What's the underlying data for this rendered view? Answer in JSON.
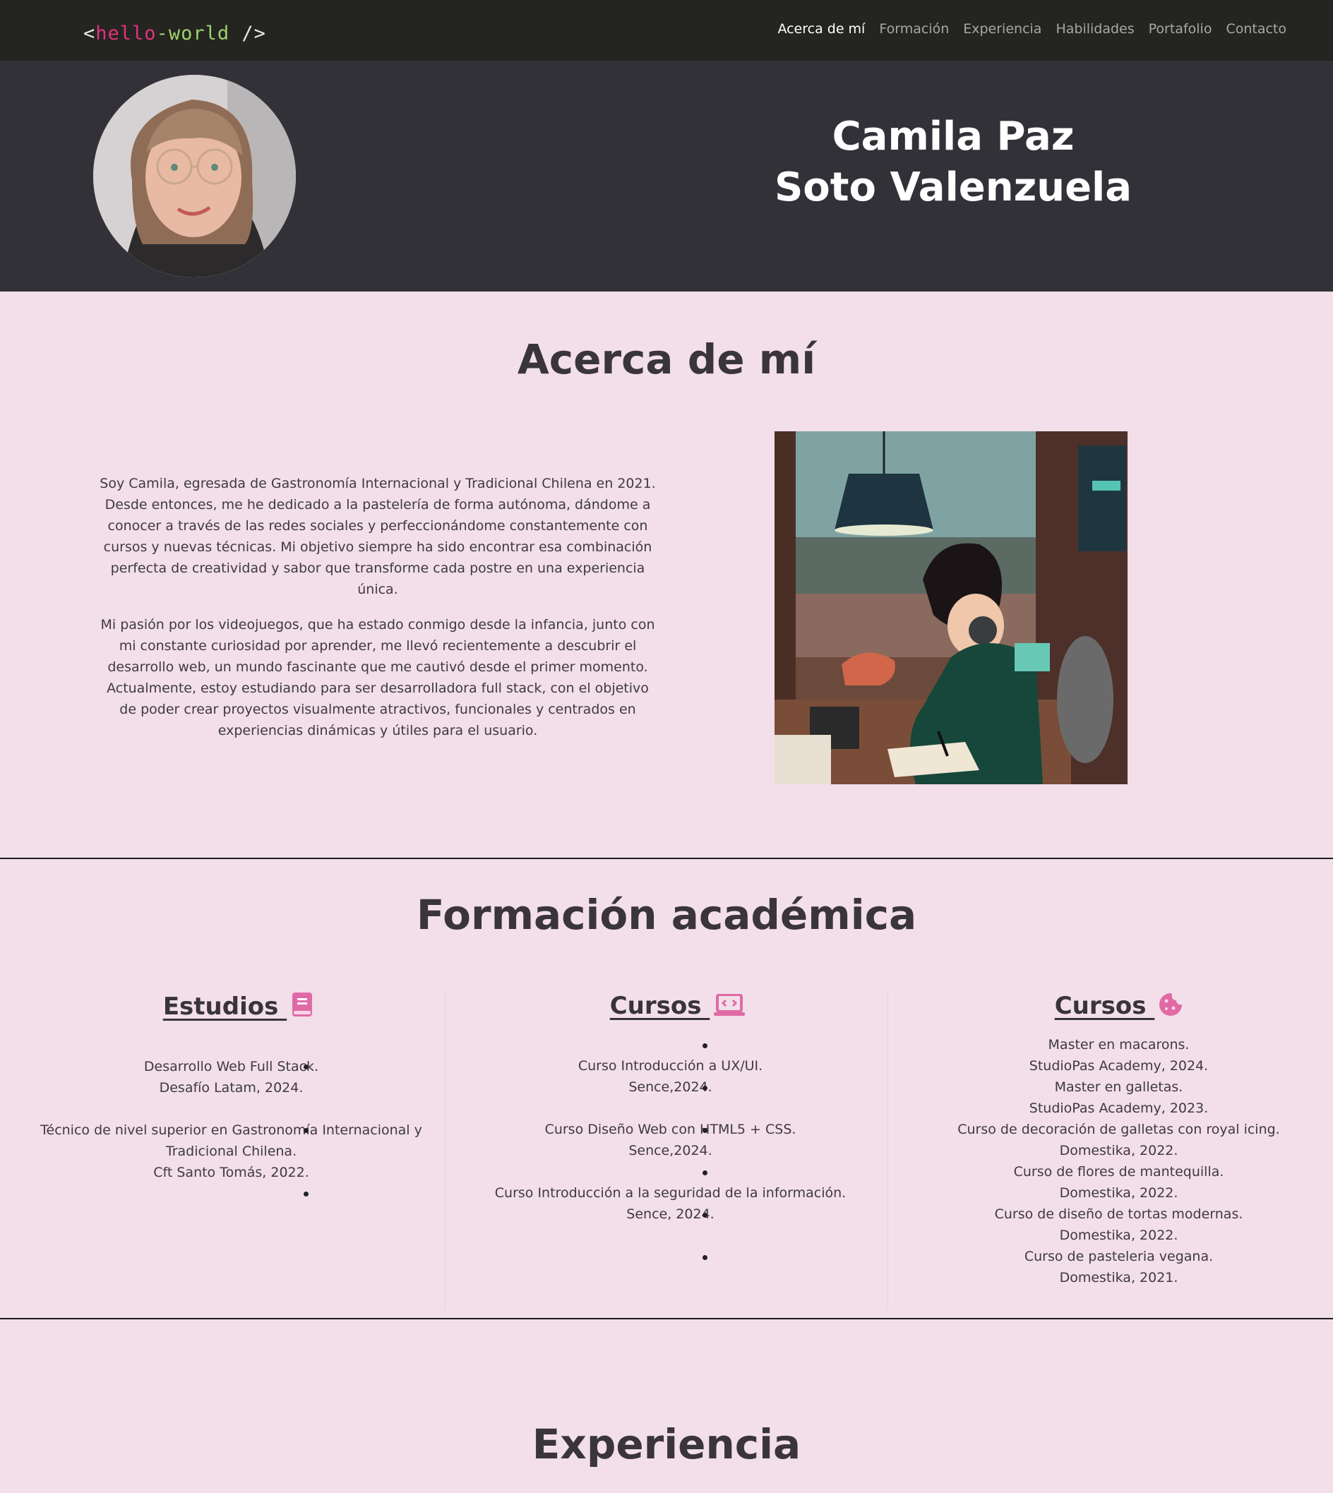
{
  "navbar": {
    "brand": {
      "open": "<",
      "hello": "hello",
      "dash": "-",
      "world": "world",
      "close": " />"
    },
    "links": [
      "Acerca de mí",
      "Formación",
      "Experiencia",
      "Habilidades",
      "Portafolio",
      "Contacto"
    ],
    "active": "Acerca de mí"
  },
  "hero": {
    "name_line1": "Camila Paz",
    "name_line2": "Soto Valenzuela"
  },
  "about": {
    "title": "Acerca de mí",
    "p1": "Soy Camila, egresada de Gastronomía Internacional y Tradicional Chilena en 2021. Desde entonces, me he dedicado a la pastelería de forma autónoma, dándome a conocer a través de las redes sociales y perfeccionándome constantemente con cursos y nuevas técnicas. Mi objetivo siempre ha sido encontrar esa combinación perfecta de creatividad y sabor que transforme cada postre en una experiencia única.",
    "p2": "Mi pasión por los videojuegos, que ha estado conmigo desde la infancia, junto con mi constante curiosidad por aprender, me llevó recientemente a descubrir el desarrollo web, un mundo fascinante que me cautivó desde el primer momento. Actualmente, estoy estudiando para ser desarrolladora full stack, con el objetivo de poder crear proyectos visualmente atractivos, funcionales y centrados en experiencias dinámicas y útiles para el usuario."
  },
  "formacion": {
    "title": "Formación académica",
    "estudios": {
      "heading": "Estudios",
      "icon": "book-icon",
      "items": [
        [
          "Desarrollo Web Full Stack.",
          "Desafío Latam, 2024."
        ],
        [
          "Técnico de nivel superior en Gastronomía Internacional y",
          "Tradicional Chilena.",
          "Cft Santo Tomás, 2022."
        ]
      ]
    },
    "cursos_web": {
      "heading": "Cursos",
      "icon": "laptop-code-icon",
      "items": [
        [
          "Curso Introducción a UX/UI.",
          "Sence,2024."
        ],
        [
          "Curso Diseño Web con HTML5 + CSS.",
          "Sence,2024."
        ],
        [
          "Curso Introducción a la seguridad de la información.",
          "Sence, 2024."
        ]
      ]
    },
    "cursos_pasteleria": {
      "heading": "Cursos",
      "icon": "cookie-icon",
      "items": [
        [
          "Master en macarons.",
          "StudioPas Academy, 2024."
        ],
        [
          "Master en galletas.",
          "StudioPas Academy, 2023."
        ],
        [
          "Curso de decoración de galletas con royal icing.",
          "Domestika, 2022."
        ],
        [
          "Curso de flores de mantequilla.",
          "Domestika, 2022."
        ],
        [
          "Curso de diseño de tortas modernas.",
          "Domestika, 2022."
        ],
        [
          "Curso de pasteleria vegana.",
          "Domestika, 2021."
        ]
      ]
    }
  },
  "experiencia": {
    "title": "Experiencia"
  },
  "colors": {
    "nav_bg": "#242421",
    "hero_bg": "#333138",
    "page_bg": "#f2dfe9",
    "accent_pink": "#e3327c",
    "accent_green": "#9fd36b",
    "icon_pink": "#e06aa6"
  }
}
